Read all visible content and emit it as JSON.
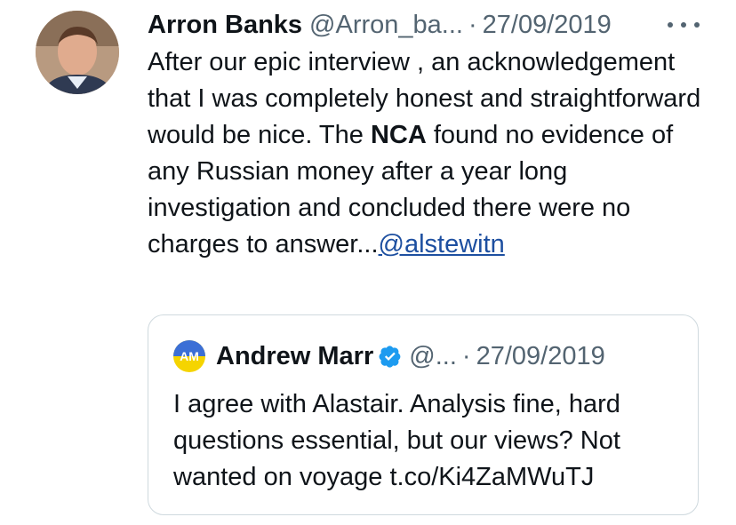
{
  "tweet": {
    "author_name": "Arron Banks",
    "author_handle": "@Arron_ba...",
    "separator": "·",
    "date": "27/09/2019",
    "text_part1": "After our epic interview , an acknowledgement that I was completely honest and straightforward would be nice. The ",
    "text_bold": "NCA",
    "text_part2": " found no evidence of any Russian money after a year long investigation and concluded there were no charges to answer...",
    "mention": "@alstewitn",
    "more_icon": "more-dots-icon"
  },
  "quoted_tweet": {
    "avatar_initials": "AM",
    "author_name": "Andrew Marr",
    "verified_icon": "verified-badge-icon",
    "author_handle": "@...",
    "separator": "·",
    "date": "27/09/2019",
    "text": "I agree with Alastair. Analysis fine, hard questions essential, but our views? Not wanted on voyage t.co/Ki4ZaMWuTJ"
  },
  "colors": {
    "text": "#0f1419",
    "secondary": "#536471",
    "link": "#1d4fa0",
    "verified": "#1d9bf0",
    "border": "#cfd9de"
  }
}
